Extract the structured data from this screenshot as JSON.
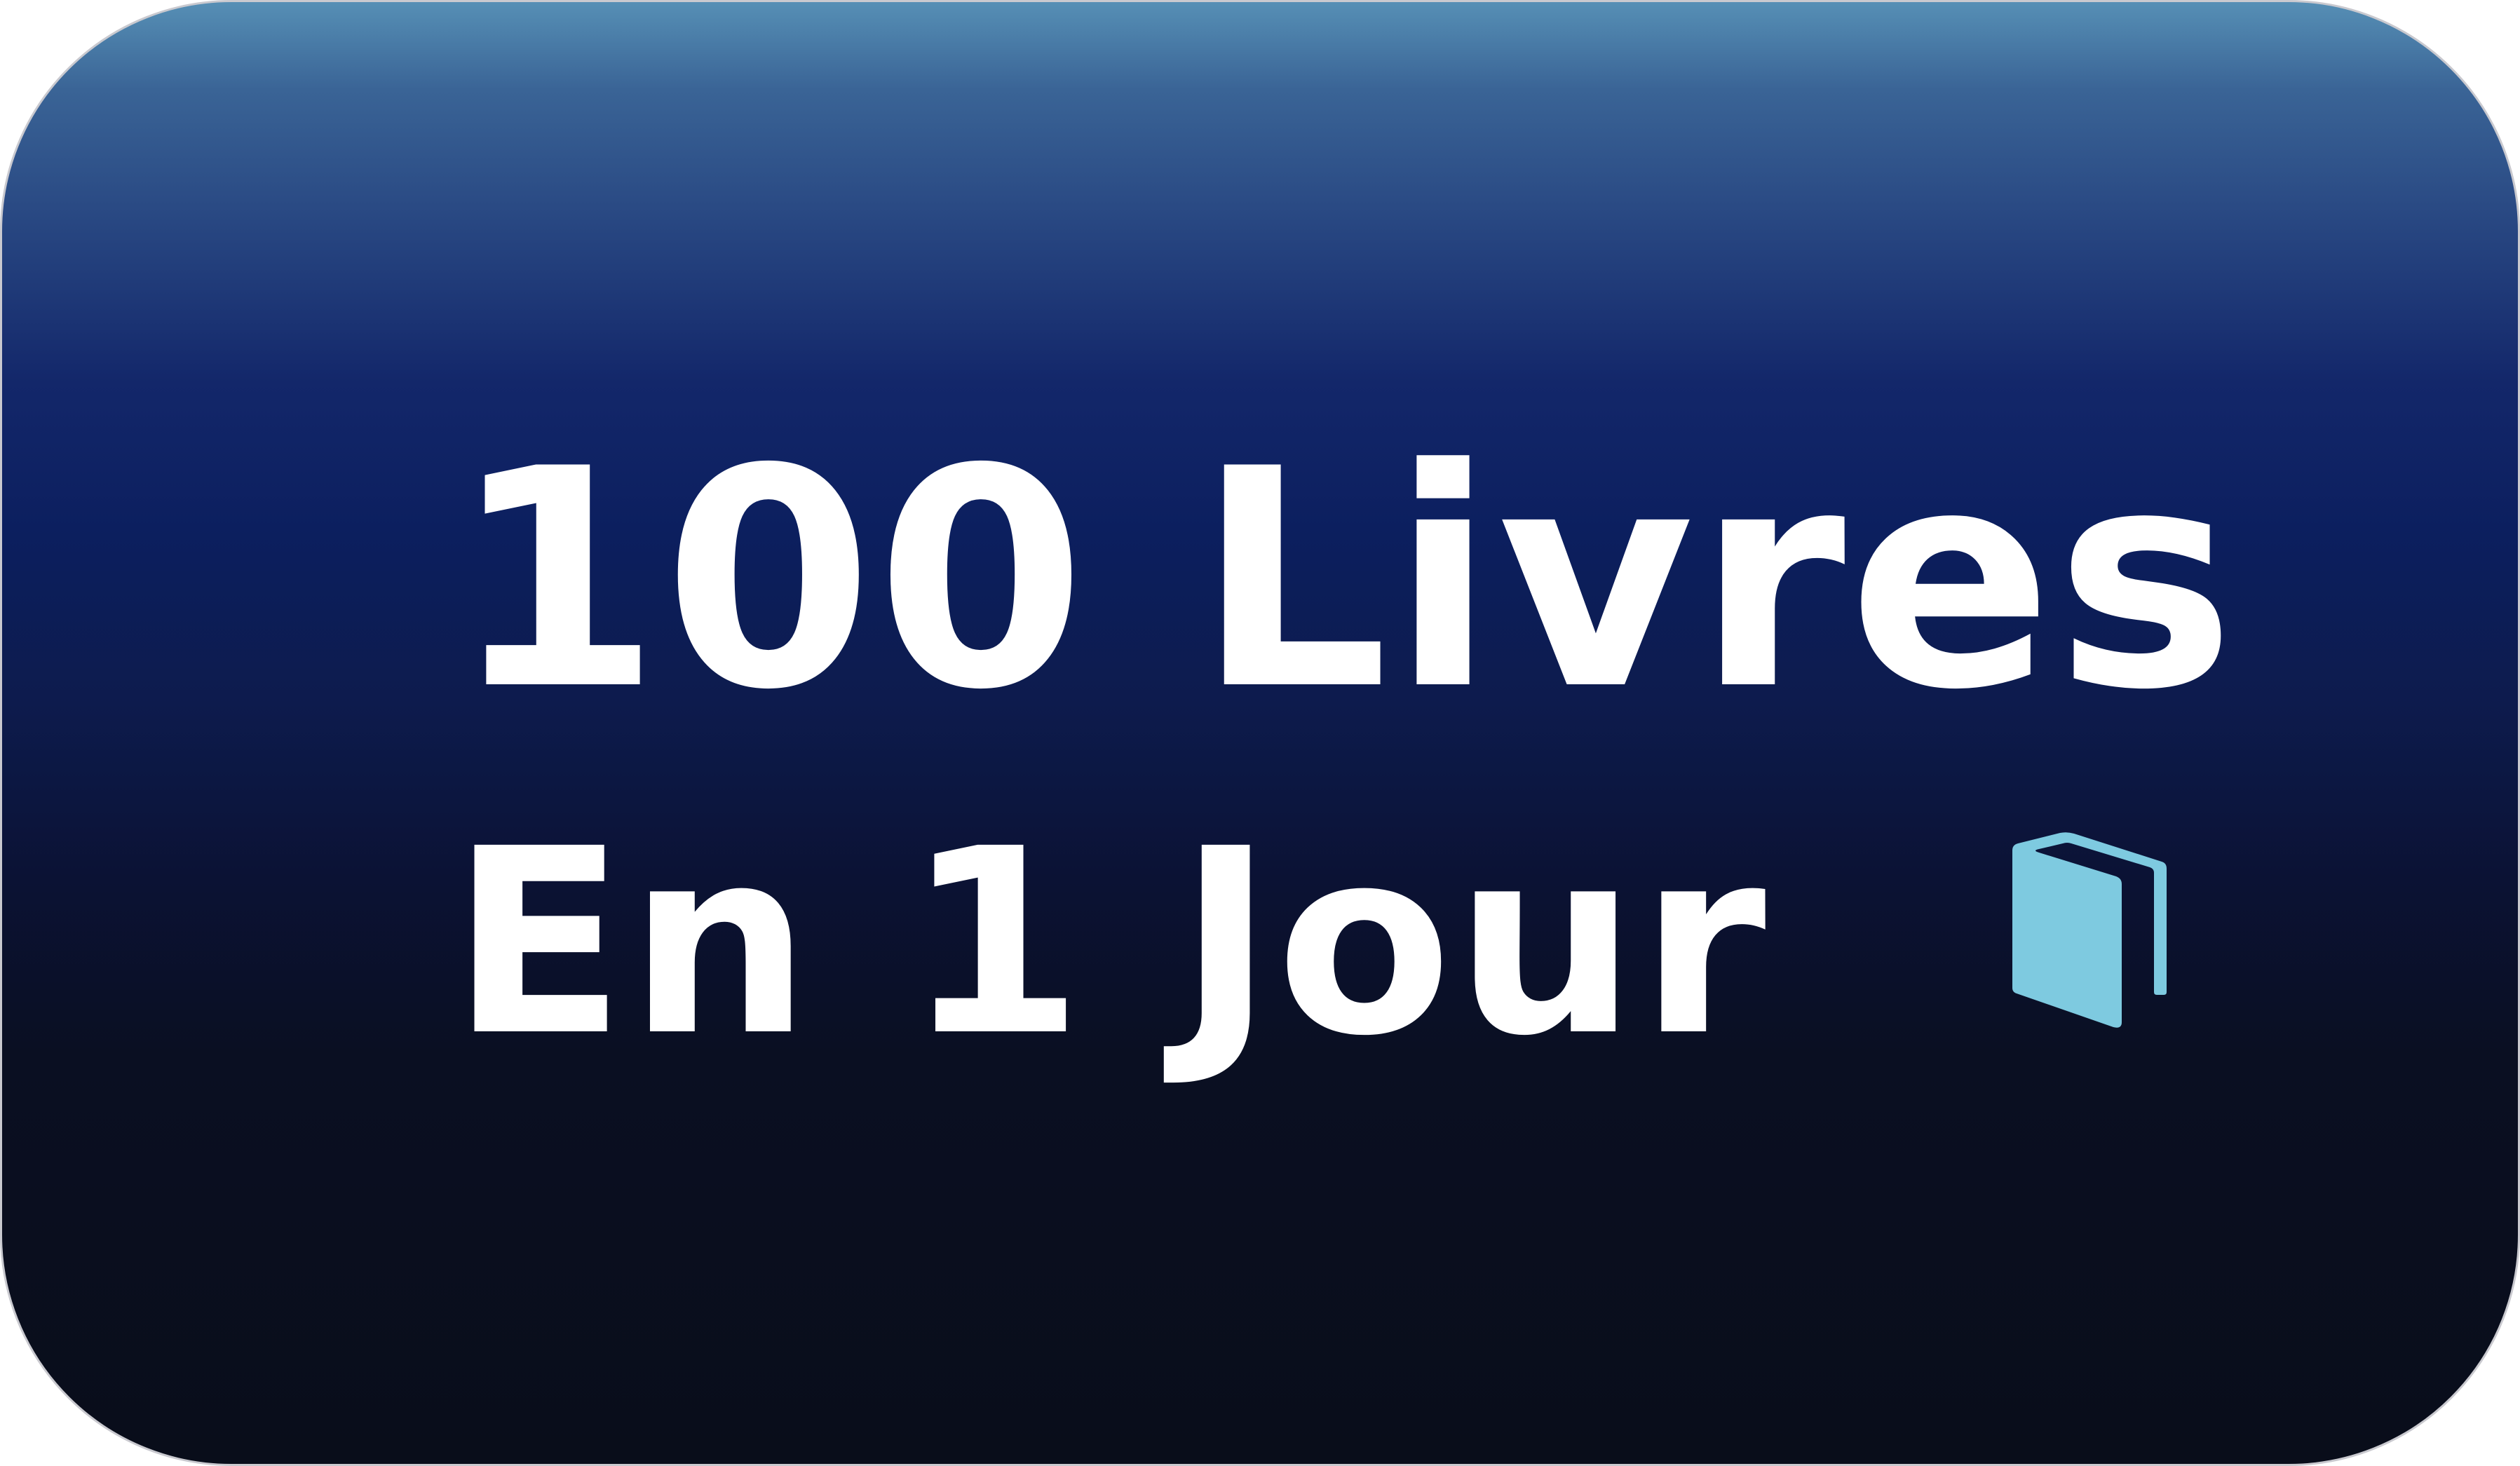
{
  "headline": {
    "line1": "100 Livres",
    "line2": "En 1 Jour"
  },
  "icon": {
    "name": "book-icon",
    "color": "#7ecae0"
  },
  "colors": {
    "text": "#ffffff",
    "gradient_top": "#568fb5",
    "gradient_mid": "#0c1f5f",
    "gradient_bottom": "#090d1a"
  }
}
